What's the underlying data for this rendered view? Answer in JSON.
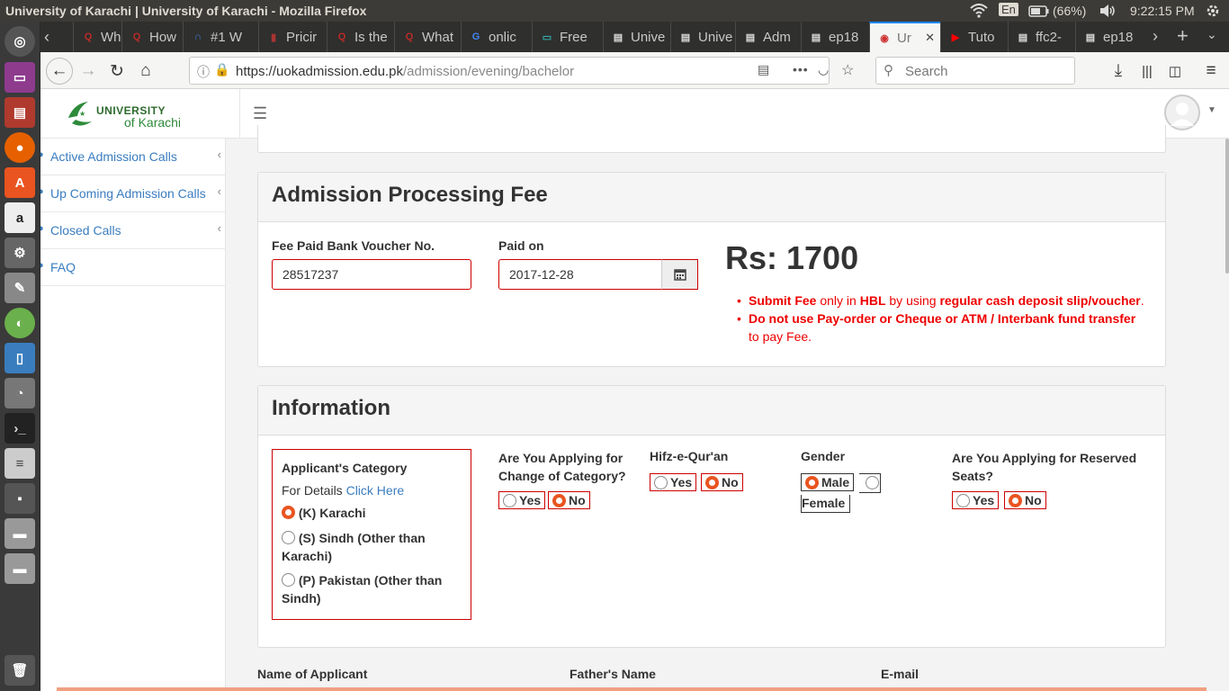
{
  "os": {
    "window_title": "University of Karachi | University of Karachi - Mozilla Firefox",
    "lang": "En",
    "battery": "(66%)",
    "clock": "9:22:15 PM"
  },
  "tabs": [
    {
      "label": "What",
      "icon": "quora-icon",
      "color": "#b92b27"
    },
    {
      "label": "How",
      "icon": "quora-icon",
      "color": "#b92b27"
    },
    {
      "label": "#1 W",
      "icon": "headset-icon",
      "color": "#3d7bd9"
    },
    {
      "label": "Pricir",
      "icon": "pricing-icon",
      "color": "#a33"
    },
    {
      "label": "Is the",
      "icon": "quora-icon",
      "color": "#b92b27"
    },
    {
      "label": "What",
      "icon": "quora-icon",
      "color": "#b92b27"
    },
    {
      "label": "onlic",
      "icon": "google-icon",
      "color": "#4285f4"
    },
    {
      "label": "Free",
      "icon": "window-icon",
      "color": "#3aa"
    },
    {
      "label": "Unive",
      "icon": "page-icon",
      "color": "#ddd"
    },
    {
      "label": "Unive",
      "icon": "page-icon",
      "color": "#ddd"
    },
    {
      "label": "Adm",
      "icon": "page-icon",
      "color": "#ddd"
    },
    {
      "label": "ep18",
      "icon": "page-icon",
      "color": "#ddd"
    },
    {
      "label": "Ur",
      "icon": "uok-icon",
      "color": "#c33",
      "active": true
    },
    {
      "label": "Tuto",
      "icon": "youtube-icon",
      "color": "#f00"
    },
    {
      "label": "ffc2-",
      "icon": "page-icon",
      "color": "#ddd"
    },
    {
      "label": "ep18",
      "icon": "page-icon",
      "color": "#ddd"
    }
  ],
  "nav": {
    "url_base": "https://uokadmission.edu.pk",
    "url_path": "/admission/evening/bachelor",
    "search_placeholder": "Search"
  },
  "site": {
    "logo_line1": "UNIVERSITY",
    "logo_line2": "of Karachi"
  },
  "sidebar": {
    "items": [
      {
        "label": "Active Admission Calls"
      },
      {
        "label": "Up Coming Admission Calls"
      },
      {
        "label": "Closed Calls"
      },
      {
        "label": "FAQ"
      }
    ]
  },
  "fee": {
    "heading": "Admission Processing Fee",
    "voucher_label": "Fee Paid Bank Voucher No.",
    "voucher_value": "28517237",
    "paid_on_label": "Paid on",
    "paid_on_value": "2017-12-28",
    "amount": "Rs: 1700",
    "note1": {
      "b1": "Submit Fee",
      "t1": " only in ",
      "b2": "HBL",
      "t2": " by using ",
      "b3": "regular cash deposit slip/voucher",
      "t3": "."
    },
    "note2": {
      "b1": "Do not use Pay-order or Cheque or ATM / Interbank fund transfer",
      "t1": " to pay Fee."
    }
  },
  "info": {
    "heading": "Information",
    "category": {
      "label": "Applicant's Category",
      "details_prefix": "For Details ",
      "details_link": "Click Here",
      "options": [
        "(K) Karachi",
        "(S) Sindh (Other than Karachi)",
        "(P) Pakistan (Other than Sindh)"
      ],
      "selected": 0
    },
    "change_category": {
      "label": "Are You Applying for Change of Category?",
      "yes": "Yes",
      "no": "No"
    },
    "hifz": {
      "label": "Hifz-e-Qur'an",
      "yes": "Yes",
      "no": "No"
    },
    "gender": {
      "label": "Gender",
      "male": "Male",
      "female": "Female"
    },
    "reserved": {
      "label": "Are You Applying for Reserved Seats?",
      "yes": "Yes",
      "no": "No"
    }
  },
  "applicant": {
    "name_label": "Name of Applicant",
    "father_label": "Father's Name",
    "email_label": "E-mail"
  }
}
